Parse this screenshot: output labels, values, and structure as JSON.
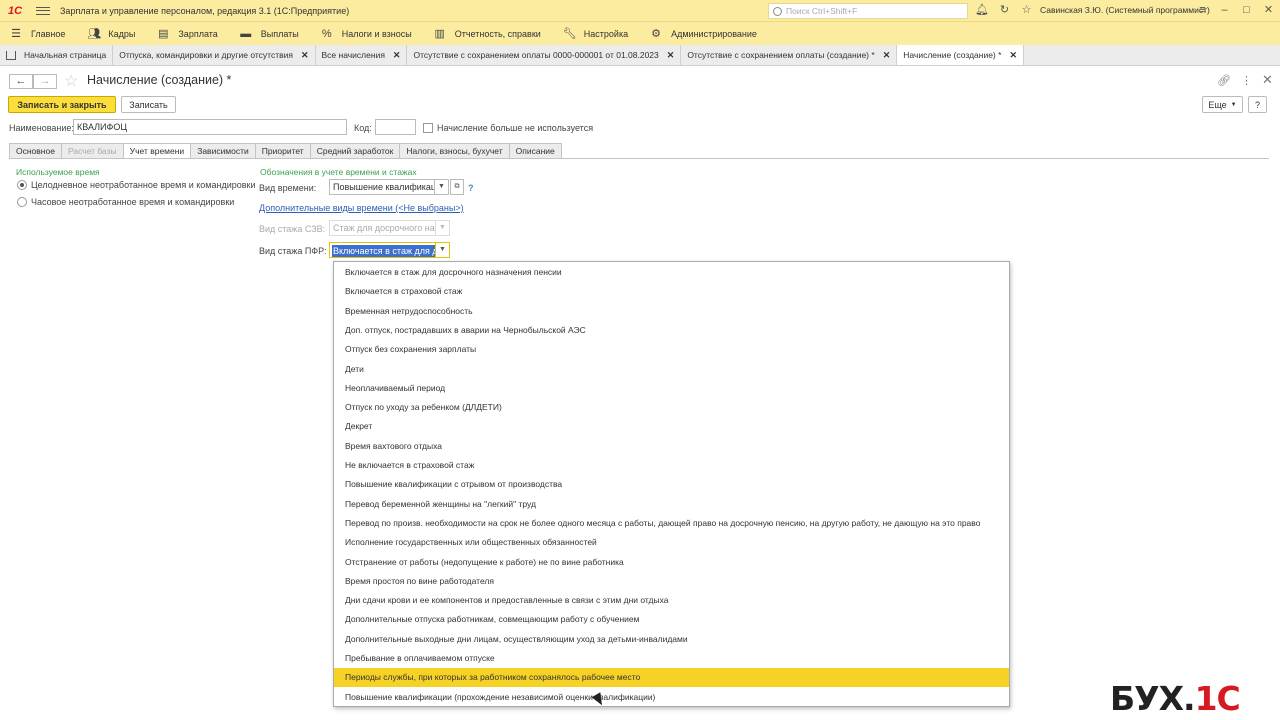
{
  "app": {
    "title": "Зарплата и управление персоналом, редакция 3.1  (1С:Предприятие)",
    "logo": "1С",
    "search_placeholder": "Поиск Ctrl+Shift+F",
    "user": "Савинская З.Ю. (Системный программист)",
    "icons": [
      "bell-icon",
      "history-icon",
      "star-icon",
      "menu-icon",
      "minimize-icon",
      "maximize-icon",
      "close-icon"
    ]
  },
  "mainmenu": [
    {
      "label": "Главное",
      "icon": "hamburger-icon"
    },
    {
      "label": "Кадры",
      "icon": "people-icon"
    },
    {
      "label": "Зарплата",
      "icon": "document-icon"
    },
    {
      "label": "Выплаты",
      "icon": "wallet-icon"
    },
    {
      "label": "Налоги и взносы",
      "icon": "percent-icon"
    },
    {
      "label": "Отчетность, справки",
      "icon": "report-icon"
    },
    {
      "label": "Настройка",
      "icon": "wrench-icon"
    },
    {
      "label": "Администрирование",
      "icon": "gear-icon"
    }
  ],
  "open_tabs": [
    "Начальная страница",
    "Отпуска, командировки и другие отсутствия",
    "Все начисления",
    "Отсутствие с сохранением оплаты 0000-000001 от 01.08.2023",
    "Отсутствие с сохранением оплаты (создание) *",
    "Начисление (создание) *"
  ],
  "form": {
    "title": "Начисление (создание) *",
    "save_close": "Записать и закрыть",
    "save": "Записать",
    "more": "Еще",
    "help": "?",
    "name_label": "Наименование:",
    "name_value": "КВАЛИФОЦ",
    "code_label": "Код:",
    "code_value": "",
    "unused_label": "Начисление больше не используется"
  },
  "form_tabs": [
    {
      "label": "Основное",
      "state": "normal"
    },
    {
      "label": "Расчет базы",
      "state": "disabled"
    },
    {
      "label": "Учет времени",
      "state": "active"
    },
    {
      "label": "Зависимости",
      "state": "normal"
    },
    {
      "label": "Приоритет",
      "state": "normal"
    },
    {
      "label": "Средний заработок",
      "state": "normal"
    },
    {
      "label": "Налоги, взносы, бухучет",
      "state": "normal"
    },
    {
      "label": "Описание",
      "state": "normal"
    }
  ],
  "time_tab": {
    "used_time_title": "Используемое время",
    "radio_full_day": "Целодневное неотработанное время и командировки",
    "radio_hourly": "Часовое неотработанное время и командировки",
    "marks_title": "Обозначения в учете времени и стажах",
    "time_kind_label": "Вид времени:",
    "time_kind_value": "Повышение квалификаци",
    "extra_kinds_link": "Дополнительные виды времени (<Не выбраны>)",
    "szv_label": "Вид стажа СЗВ:",
    "szv_value": "Стаж для досрочного наз",
    "pfr_label": "Вид стажа ПФР:",
    "pfr_value": "Включается в стаж для д"
  },
  "dropdown_options": [
    "Включается в стаж для досрочного назначения пенсии",
    "Включается в страховой стаж",
    "Временная нетрудоспособность",
    "Доп. отпуск, пострадавших в аварии на Чернобыльской АЭС",
    "Отпуск без сохранения зарплаты",
    "Дети",
    "Неоплачиваемый период",
    "Отпуск по уходу за ребенком (ДЛДЕТИ)",
    "Декрет",
    "Время вахтового отдыха",
    "Не включается в страховой стаж",
    "Повышение квалификации с отрывом от производства",
    "Перевод беременной женщины на \"легкий\" труд",
    "Перевод по произв. необходимости на срок не более одного месяца с работы, дающей право на досрочную пенсию, на другую работу, не дающую на это право",
    "Исполнение государственных или общественных обязанностей",
    "Отстранение от работы (недопущение к работе) не по вине работника",
    "Время простоя по вине работодателя",
    "Дни сдачи крови и ее компонентов и предоставленные в связи с этим дни отдыха",
    "Дополнительные отпуска работникам, совмещающим работу с обучением",
    "Дополнительные выходные дни лицам, осуществляющим уход за детьми-инвалидами",
    "Пребывание в оплачиваемом отпуске",
    "Периоды службы, при которых за работником сохранялось рабочее место",
    "Повышение квалификации (прохождение независимой оценки квалификации)"
  ],
  "highlighted_option_index": 21,
  "brand": {
    "left": "БУХ.",
    "right": "1С"
  },
  "colors": {
    "toolbar": "#fbeca0",
    "primary_button": "#fbde3c",
    "highlight": "#f6d226",
    "section_title": "#3aa050",
    "link": "#2c5eb5"
  }
}
